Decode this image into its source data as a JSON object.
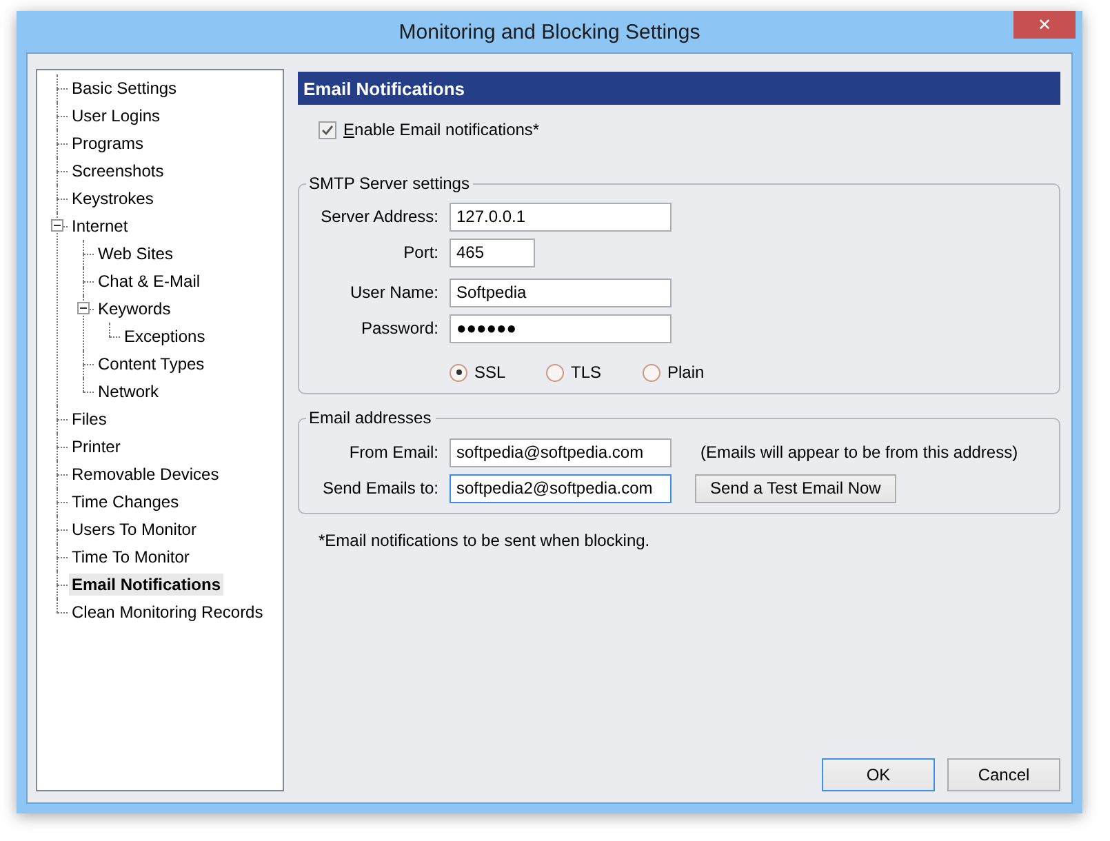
{
  "window": {
    "title": "Monitoring and Blocking Settings",
    "close": "✕"
  },
  "tree": [
    {
      "label": "Basic Settings",
      "selected": false
    },
    {
      "label": "User Logins",
      "selected": false
    },
    {
      "label": "Programs",
      "selected": false
    },
    {
      "label": "Screenshots",
      "selected": false
    },
    {
      "label": "Keystrokes",
      "selected": false
    },
    {
      "label": "Internet",
      "selected": false,
      "expanded": true,
      "children": [
        {
          "label": "Web Sites",
          "selected": false
        },
        {
          "label": "Chat & E-Mail",
          "selected": false
        },
        {
          "label": "Keywords",
          "selected": false,
          "expanded": true,
          "children": [
            {
              "label": "Exceptions",
              "selected": false
            }
          ]
        },
        {
          "label": "Content Types",
          "selected": false
        },
        {
          "label": "Network",
          "selected": false
        }
      ]
    },
    {
      "label": "Files",
      "selected": false
    },
    {
      "label": "Printer",
      "selected": false
    },
    {
      "label": "Removable Devices",
      "selected": false
    },
    {
      "label": "Time Changes",
      "selected": false
    },
    {
      "label": "Users To Monitor",
      "selected": false
    },
    {
      "label": "Time To Monitor",
      "selected": false
    },
    {
      "label": "Email Notifications",
      "selected": true
    },
    {
      "label": "Clean Monitoring Records",
      "selected": false
    }
  ],
  "section_title": "Email Notifications",
  "enable": {
    "label": "Enable Email notifications*",
    "checked": true
  },
  "smtp": {
    "title": "SMTP Server settings",
    "fields": [
      {
        "label": "Server Address:",
        "value": "127.0.0.1",
        "kind": "wide",
        "focused": false
      },
      {
        "label": "Port:",
        "value": "465",
        "kind": "short",
        "focused": false
      },
      {
        "label": "User Name:",
        "value": "Softpedia",
        "kind": "wide",
        "focused": false
      },
      {
        "label": "Password:",
        "value": "●●●●●●",
        "kind": "wide",
        "focused": false
      }
    ],
    "security": [
      {
        "label": "SSL",
        "selected": true
      },
      {
        "label": "TLS",
        "selected": false
      },
      {
        "label": "Plain",
        "selected": false
      }
    ]
  },
  "addresses": {
    "title": "Email addresses",
    "fields": [
      {
        "label": "From Email:",
        "value": "softpedia@softpedia.com",
        "focused": false,
        "note": "(Emails will appear to be from this address)"
      },
      {
        "label": "Send Emails to:",
        "value": "softpedia2@softpedia.com",
        "focused": true,
        "button": "Send a Test Email Now"
      }
    ]
  },
  "footnote": "*Email notifications to be sent when blocking.",
  "buttons": [
    {
      "label": "OK",
      "default": true
    },
    {
      "label": "Cancel",
      "default": false
    }
  ]
}
